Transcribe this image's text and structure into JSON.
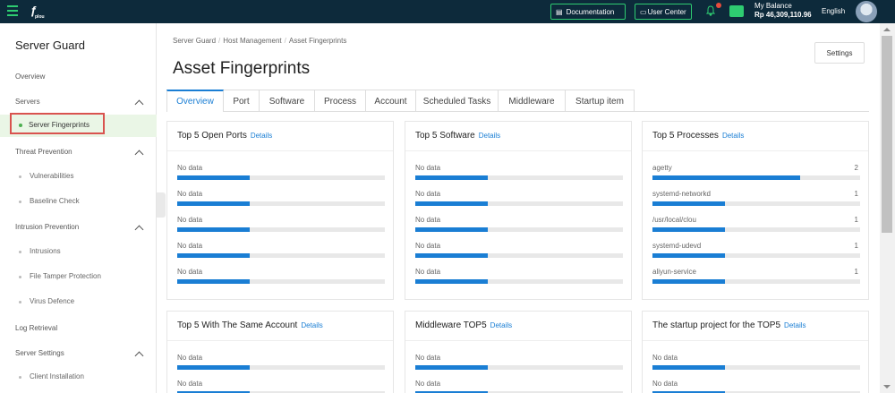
{
  "topbar": {
    "logo_text": "ƒ",
    "logo_sub": "plou",
    "documentation": "Documentation",
    "user_center": "User Center",
    "balance_label": "My Balance",
    "balance_value": "Rp 46,309,110.96",
    "language": "English",
    "accent": "#2ecc71"
  },
  "sidebar": {
    "title": "Server Guard",
    "overview": "Overview",
    "servers": "Servers",
    "server_fingerprints": "Server Fingerprints",
    "threat_prevention": "Threat Prevention",
    "vulnerabilities": "Vulnerabilities",
    "baseline_check": "Baseline Check",
    "intrusion_prevention": "Intrusion Prevention",
    "intrusions": "Intrusions",
    "file_tamper": "File Tamper Protection",
    "virus_defence": "Virus Defence",
    "log_retrieval": "Log Retrieval",
    "server_settings": "Server Settings",
    "client_installation": "Client Installation"
  },
  "breadcrumb": [
    "Server Guard",
    "Host Management",
    "Asset Fingerprints"
  ],
  "page_title": "Asset Fingerprints",
  "settings_label": "Settings",
  "tabs": [
    "Overview",
    "Port",
    "Software",
    "Process",
    "Account",
    "Scheduled Tasks",
    "Middleware",
    "Startup item"
  ],
  "details_label": "Details",
  "cards": [
    {
      "title": "Top 5 Open Ports",
      "rows": [
        {
          "label": "No data",
          "count": "",
          "fill": 0.35
        },
        {
          "label": "No data",
          "count": "",
          "fill": 0.35
        },
        {
          "label": "No data",
          "count": "",
          "fill": 0.35
        },
        {
          "label": "No data",
          "count": "",
          "fill": 0.35
        },
        {
          "label": "No data",
          "count": "",
          "fill": 0.35
        }
      ]
    },
    {
      "title": "Top 5 Software",
      "rows": [
        {
          "label": "No data",
          "count": "",
          "fill": 0.35
        },
        {
          "label": "No data",
          "count": "",
          "fill": 0.35
        },
        {
          "label": "No data",
          "count": "",
          "fill": 0.35
        },
        {
          "label": "No data",
          "count": "",
          "fill": 0.35
        },
        {
          "label": "No data",
          "count": "",
          "fill": 0.35
        }
      ]
    },
    {
      "title": "Top 5 Processes",
      "rows": [
        {
          "label": "agetty",
          "count": "2",
          "fill": 0.71
        },
        {
          "label": "systemd-networkd",
          "count": "1",
          "fill": 0.35
        },
        {
          "label": "/usr/local/clou",
          "count": "1",
          "fill": 0.35
        },
        {
          "label": "systemd-udevd",
          "count": "1",
          "fill": 0.35
        },
        {
          "label": "aliyun-service",
          "count": "1",
          "fill": 0.35
        }
      ]
    },
    {
      "title": "Top 5 With The Same Account",
      "rows": [
        {
          "label": "No data",
          "count": "",
          "fill": 0.35
        },
        {
          "label": "No data",
          "count": "",
          "fill": 0.35
        }
      ]
    },
    {
      "title": "Middleware TOP5",
      "rows": [
        {
          "label": "No data",
          "count": "",
          "fill": 0.35
        },
        {
          "label": "No data",
          "count": "",
          "fill": 0.35
        }
      ]
    },
    {
      "title": "The startup project for the TOP5",
      "rows": [
        {
          "label": "No data",
          "count": "",
          "fill": 0.35
        },
        {
          "label": "No data",
          "count": "",
          "fill": 0.35
        }
      ]
    }
  ]
}
